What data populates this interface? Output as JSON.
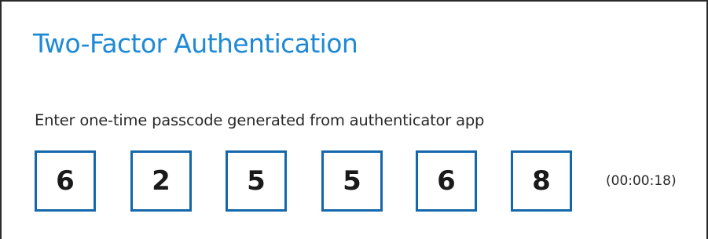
{
  "title": "Two-Factor Authentication",
  "instruction": "Enter one-time passcode generated from authenticator app",
  "passcode_digits": [
    "6",
    "2",
    "5",
    "5",
    "6",
    "8"
  ],
  "timer": "(00:00:18)",
  "colors": {
    "title": "#1e8ad6",
    "digit_border": "#1567ab",
    "text": "#2a2a2a"
  }
}
